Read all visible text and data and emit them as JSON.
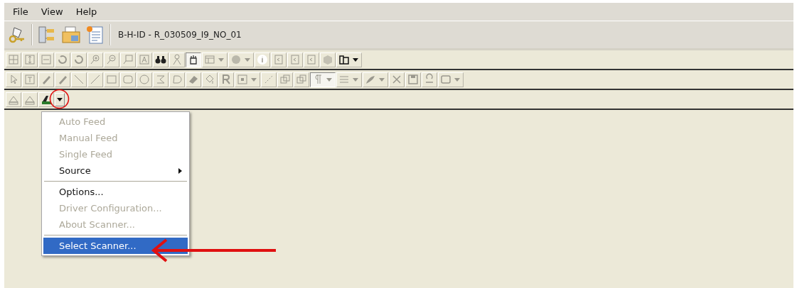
{
  "menubar": [
    {
      "label": "File"
    },
    {
      "label": "View"
    },
    {
      "label": "Help"
    }
  ],
  "document_title": "B-H-ID - R_030509_I9_NO_01",
  "scan_menu": {
    "items": [
      {
        "kind": "item",
        "label": "Auto Feed",
        "disabled": true,
        "selected": false,
        "submenu": false
      },
      {
        "kind": "item",
        "label": "Manual Feed",
        "disabled": true,
        "selected": false,
        "submenu": false
      },
      {
        "kind": "item",
        "label": "Single Feed",
        "disabled": true,
        "selected": false,
        "submenu": false
      },
      {
        "kind": "item",
        "label": "Source",
        "disabled": false,
        "selected": false,
        "submenu": true
      },
      {
        "kind": "separator"
      },
      {
        "kind": "item",
        "label": "Options...",
        "disabled": false,
        "selected": false,
        "submenu": false
      },
      {
        "kind": "item",
        "label": "Driver Configuration...",
        "disabled": true,
        "selected": false,
        "submenu": false
      },
      {
        "kind": "item",
        "label": "About Scanner...",
        "disabled": true,
        "selected": false,
        "submenu": false
      },
      {
        "kind": "separator"
      },
      {
        "kind": "item",
        "label": "Select Scanner...",
        "disabled": false,
        "selected": true,
        "submenu": false
      }
    ]
  }
}
